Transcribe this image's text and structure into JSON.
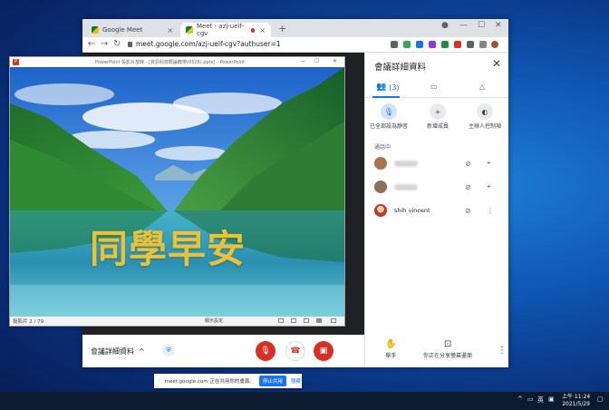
{
  "browser": {
    "tabs": [
      {
        "label": "Google Meet",
        "active": false
      },
      {
        "label": "Meet - azj-ueif-cgv",
        "active": true
      }
    ],
    "url": "meet.google.com/azj-ueif-cgv?authuser=1"
  },
  "ppt": {
    "title": "PowerPoint 投影片放映 - [資訊科技概論教學(0526).pptx] - PowerPoint",
    "slide_text": "同學早安",
    "status": "投影片 2 / 79",
    "view_label": "顯示設定"
  },
  "panel": {
    "title": "會議詳細資料",
    "people_count": "(3)",
    "actions": [
      {
        "label": "已全部設為靜音",
        "icon": "mic-off-icon"
      },
      {
        "label": "新增成員",
        "icon": "add-person-icon"
      },
      {
        "label": "主辦人控制項",
        "icon": "toggle-icon"
      }
    ],
    "section": "通話中",
    "people": [
      {
        "name": ""
      },
      {
        "name": ""
      },
      {
        "name": "shih vincent"
      }
    ]
  },
  "bottombar": {
    "details_label": "會議詳細資料",
    "raise_hand": "舉手",
    "presenting": "你正在分享螢幕畫面"
  },
  "sharebar": {
    "text": "meet.google.com 正在共用你的畫面。",
    "stop_label": "停止共用",
    "hide_label": "隱藏"
  },
  "taskbar": {
    "ime": "英",
    "time": "上午 11:24",
    "date": "2021/5/29"
  },
  "colors": {
    "meet_red": "#d93025",
    "meet_blue": "#1a73e8",
    "slide_text": "#e8c23a"
  }
}
